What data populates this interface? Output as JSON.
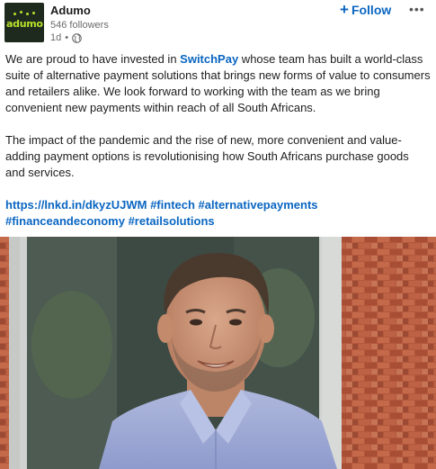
{
  "header": {
    "company_name": "Adumo",
    "followers": "546 followers",
    "time": "1d",
    "dot": "•",
    "follow_label": "Follow",
    "follow_plus": "+",
    "more": "•••",
    "logo_text": "adumo"
  },
  "post": {
    "p1_before": "We are proud to have invested in ",
    "p1_mention": "SwitchPay",
    "p1_after": " whose team has built a world-class suite of alternative payment solutions that brings new forms of value to consumers and retailers alike. We look forward to working with the team as we bring convenient new payments within reach of all South Africans.",
    "p2": "The impact of the pandemic and the rise of new, more convenient and value-adding payment options is revolutionising how South Africans purchase goods and services.",
    "link": "https://lnkd.in/dkyzUJWM",
    "tags": [
      "#fintech",
      "#alternativepayments",
      "#financeandeconomy",
      "#retailsolutions"
    ]
  },
  "colors": {
    "link_blue": "#0a66c2",
    "logo_bg": "#1f2a1f",
    "logo_green": "#b6e22a"
  },
  "icons": {
    "globe": "globe-icon",
    "more": "more-options-icon"
  }
}
